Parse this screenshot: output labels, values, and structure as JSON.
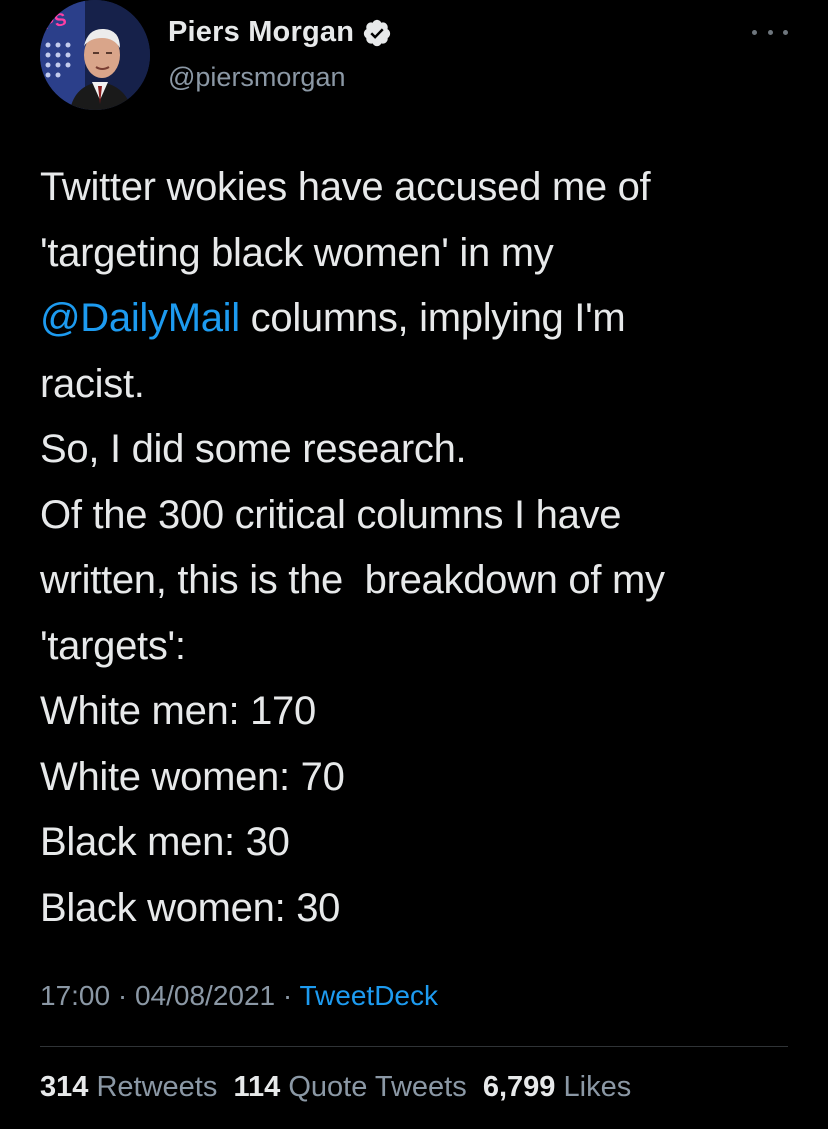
{
  "author": {
    "display_name": "Piers Morgan",
    "handle": "@piersmorgan",
    "avatar_badge_text": "PS"
  },
  "tweet": {
    "lines": [
      {
        "text": "Twitter wokies have accused me of"
      },
      {
        "text": "'targeting black women' in my"
      },
      {
        "mention": "@DailyMail",
        "text": " columns, implying I'm"
      },
      {
        "text": "racist."
      },
      {
        "text": "So, I did some research."
      },
      {
        "text": "Of the 300 critical columns I have"
      },
      {
        "text": "written, this is the  breakdown of my"
      },
      {
        "text": "'targets':"
      },
      {
        "text": "White men: 170"
      },
      {
        "text": "White women: 70"
      },
      {
        "text": "Black men: 30"
      },
      {
        "text": "Black women: 30"
      }
    ]
  },
  "meta": {
    "time": "17:00",
    "separator": " · ",
    "date": "04/08/2021",
    "source": "TweetDeck"
  },
  "stats": {
    "retweets_count": "314",
    "retweets_label": "Retweets",
    "quotes_count": "114",
    "quotes_label": "Quote Tweets",
    "likes_count": "6,799",
    "likes_label": "Likes"
  },
  "colors": {
    "background": "#000000",
    "text": "#e7e9ea",
    "muted": "#8b98a5",
    "accent": "#1d9bf0"
  },
  "icons": {
    "verified": "verified-badge-icon",
    "more": "more-options-icon"
  }
}
